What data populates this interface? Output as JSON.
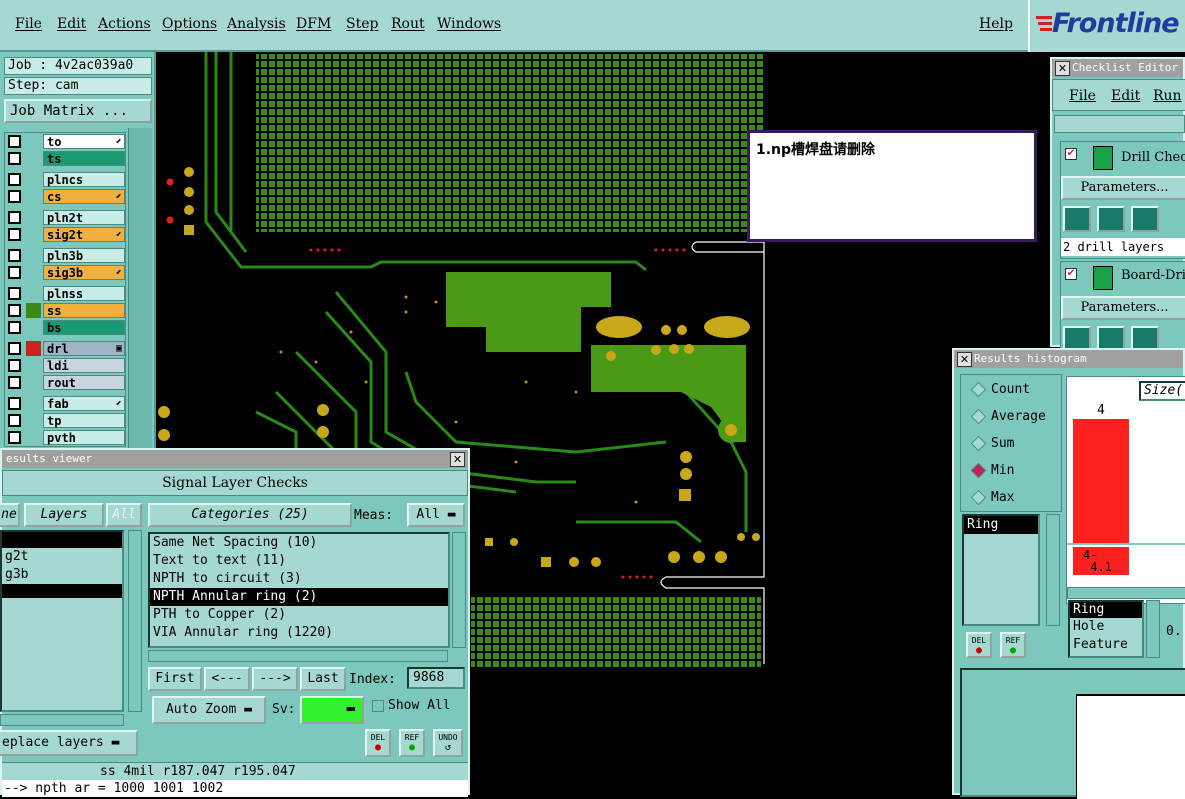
{
  "menubar": {
    "items": [
      "File",
      "Edit",
      "Actions",
      "Options",
      "Analysis",
      "DFM",
      "Step",
      "Rout",
      "Windows"
    ],
    "help": "Help"
  },
  "logo": {
    "text": "Frontline"
  },
  "left_panel": {
    "job": "Job : 4v2ac039a0",
    "step": "Step: cam",
    "job_matrix": "Job Matrix ...",
    "layers": [
      {
        "name": "to",
        "color": "#ffffff",
        "mark": "arrow"
      },
      {
        "name": "ts",
        "color": "#1a9a70",
        "mark": ""
      },
      {
        "name": "plncs",
        "color": "#c8ece6",
        "mark": ""
      },
      {
        "name": "cs",
        "color": "#f0b040",
        "mark": "arrow"
      },
      {
        "name": "pln2t",
        "color": "#c8ece6",
        "mark": ""
      },
      {
        "name": "sig2t",
        "color": "#f0b040",
        "mark": "arrow"
      },
      {
        "name": "pln3b",
        "color": "#c8ece6",
        "mark": ""
      },
      {
        "name": "sig3b",
        "color": "#f0b040",
        "mark": "arrow"
      },
      {
        "name": "plnss",
        "color": "#c8ece6",
        "mark": ""
      },
      {
        "name": "ss",
        "color": "#f0b040",
        "mark": ""
      },
      {
        "name": "bs",
        "color": "#1a9a70",
        "mark": ""
      },
      {
        "name": "drl",
        "color": "#a0b4c8",
        "mark": "box"
      },
      {
        "name": "ldi",
        "color": "#c8d4e0",
        "mark": ""
      },
      {
        "name": "rout",
        "color": "#c8d4e0",
        "mark": ""
      },
      {
        "name": "fab",
        "color": "#c8ece6",
        "mark": "arrow"
      },
      {
        "name": "tp",
        "color": "#c8ece6",
        "mark": ""
      },
      {
        "name": "pvth",
        "color": "#c8ece6",
        "mark": ""
      }
    ]
  },
  "annotation": {
    "text": "1.np槽焊盘请删除"
  },
  "results_viewer": {
    "title": "esults viewer",
    "header": "Signal Layer Checks",
    "left_tab": "ne",
    "layers_tab": "Layers",
    "all_tab": "All",
    "layers_list": [
      "",
      "g2t",
      "g3b",
      ""
    ],
    "categories_label": "Categories (25)",
    "meas_label": "Meas:",
    "meas_value": "All",
    "categories": [
      "Same Net Spacing (10)",
      "Text to text (11)",
      "NPTH to circuit (3)",
      "NPTH Annular ring (2)",
      "PTH to Copper (2)",
      "VIA Annular ring (1220)"
    ],
    "selected_category": 3,
    "nav": {
      "first": "First",
      "prev": "<---",
      "next": "--->",
      "last": "Last",
      "index_label": "Index:",
      "index_value": "9868"
    },
    "auto_zoom": "Auto Zoom",
    "sv_label": "Sv:",
    "sv_color": "#30f030",
    "show_all": "Show All",
    "replace_layers": "eplace layers",
    "del": "DEL",
    "ref": "REF",
    "undo": "UNDO",
    "status": "ss 4mil   r187.047   r195.047",
    "status2": "--> npth ar = 1000 1001 1002"
  },
  "checklist": {
    "title": "Checklist Editor",
    "menu": [
      "File",
      "Edit",
      "Run"
    ],
    "checks": [
      {
        "name": "Drill Chec",
        "params": "Parameters...",
        "info": "2 drill layers"
      },
      {
        "name": "Board-Dri",
        "params": "Parameters..."
      }
    ]
  },
  "histogram": {
    "title": "Results histogram",
    "radios": [
      "Count",
      "Average",
      "Sum",
      "Min",
      "Max"
    ],
    "selected_radio": "Min",
    "list": [
      "Ring"
    ],
    "size_label": "Size(",
    "bar1_value": "4",
    "bar2_label": "4-",
    "bar2_sub": "4.1",
    "bar_color": "#ff2020",
    "type_list": [
      "Ring",
      "Hole",
      "Feature"
    ],
    "zero": "0.",
    "del": "DEL",
    "ref": "REF"
  }
}
